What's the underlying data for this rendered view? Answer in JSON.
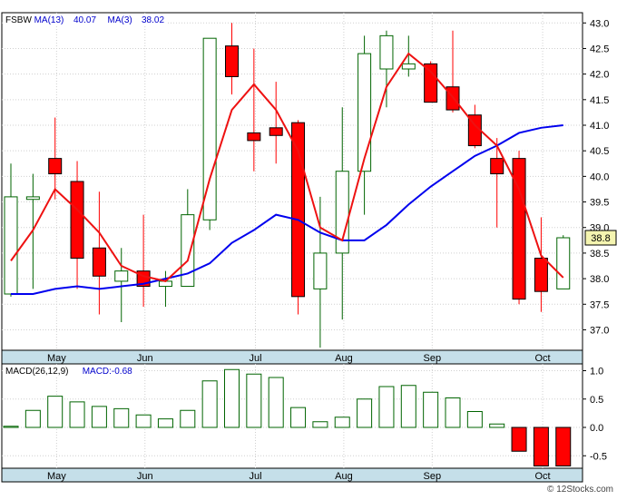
{
  "symbol": "FSBW",
  "credit": "© 12Stocks.com",
  "colors": {
    "up": "#006400",
    "down": "#ff0000",
    "ma_long": "#0000ee",
    "ma_short": "#ee1111",
    "axis_band": "#c5dfe9",
    "grid": "#d0d0d0"
  },
  "chart_data": [
    {
      "type": "candlestick",
      "legend": [
        {
          "text": "FSBW",
          "color": "#000000"
        },
        {
          "text": "MA(13)",
          "color": "#0000cc"
        },
        {
          "text": "40.07",
          "color": "#0000cc"
        },
        {
          "text": "MA(3)",
          "color": "#0000cc"
        },
        {
          "text": "38.02",
          "color": "#0000cc"
        }
      ],
      "last_price_label": "38.8",
      "ylim": [
        36.6,
        43.2
      ],
      "y_ticks": [
        "43.0",
        "42.5",
        "42.0",
        "41.5",
        "41.0",
        "40.5",
        "40.0",
        "39.5",
        "39.0",
        "38.5",
        "38.0",
        "37.5",
        "37.0"
      ],
      "x_ticks": [
        {
          "label": "May",
          "i": 1
        },
        {
          "label": "Jun",
          "i": 5
        },
        {
          "label": "Jul",
          "i": 10
        },
        {
          "label": "Aug",
          "i": 14
        },
        {
          "label": "Sep",
          "i": 18
        },
        {
          "label": "Oct",
          "i": 23
        }
      ],
      "candles": [
        {
          "o": 37.7,
          "h": 40.25,
          "l": 37.65,
          "c": 39.6
        },
        {
          "o": 39.55,
          "h": 40.05,
          "l": 37.8,
          "c": 39.6
        },
        {
          "o": 40.35,
          "h": 41.15,
          "l": 39.55,
          "c": 40.05
        },
        {
          "o": 39.9,
          "h": 40.3,
          "l": 37.8,
          "c": 38.4
        },
        {
          "o": 38.6,
          "h": 39.7,
          "l": 37.3,
          "c": 38.05
        },
        {
          "o": 37.95,
          "h": 38.6,
          "l": 37.15,
          "c": 38.15
        },
        {
          "o": 38.15,
          "h": 39.25,
          "l": 37.45,
          "c": 37.85
        },
        {
          "o": 37.85,
          "h": 38.15,
          "l": 37.45,
          "c": 37.95
        },
        {
          "o": 37.85,
          "h": 39.75,
          "l": 37.85,
          "c": 39.25
        },
        {
          "o": 39.15,
          "h": 42.65,
          "l": 38.95,
          "c": 42.7
        },
        {
          "o": 42.55,
          "h": 43.0,
          "l": 41.6,
          "c": 41.95
        },
        {
          "o": 40.85,
          "h": 42.5,
          "l": 40.1,
          "c": 40.7
        },
        {
          "o": 40.95,
          "h": 41.85,
          "l": 40.25,
          "c": 40.8
        },
        {
          "o": 41.05,
          "h": 41.1,
          "l": 37.3,
          "c": 37.65
        },
        {
          "o": 37.8,
          "h": 39.6,
          "l": 36.65,
          "c": 38.5
        },
        {
          "o": 38.5,
          "h": 41.35,
          "l": 37.2,
          "c": 40.1
        },
        {
          "o": 40.1,
          "h": 42.75,
          "l": 39.25,
          "c": 42.4
        },
        {
          "o": 42.1,
          "h": 42.85,
          "l": 41.35,
          "c": 42.75
        },
        {
          "o": 42.1,
          "h": 42.75,
          "l": 41.95,
          "c": 42.2
        },
        {
          "o": 42.2,
          "h": 42.25,
          "l": 41.45,
          "c": 41.45
        },
        {
          "o": 41.75,
          "h": 42.85,
          "l": 41.25,
          "c": 41.3
        },
        {
          "o": 41.2,
          "h": 41.4,
          "l": 40.55,
          "c": 40.6
        },
        {
          "o": 40.35,
          "h": 40.75,
          "l": 39.0,
          "c": 40.05
        },
        {
          "o": 40.35,
          "h": 40.5,
          "l": 37.5,
          "c": 37.6
        },
        {
          "o": 38.4,
          "h": 39.2,
          "l": 37.35,
          "c": 37.75
        },
        {
          "o": 37.8,
          "h": 38.85,
          "l": 37.8,
          "c": 38.8
        }
      ],
      "ma13": [
        37.7,
        37.7,
        37.8,
        37.85,
        37.8,
        37.85,
        37.9,
        38.0,
        38.1,
        38.3,
        38.7,
        38.95,
        39.25,
        39.15,
        38.9,
        38.75,
        38.75,
        39.05,
        39.45,
        39.8,
        40.1,
        40.4,
        40.6,
        40.85,
        40.95,
        41.0
      ],
      "ma13_start": 0,
      "ma3": [
        38.35,
        38.95,
        39.75,
        39.35,
        38.9,
        38.25,
        38.05,
        37.95,
        38.35,
        39.95,
        41.3,
        41.8,
        41.3,
        40.5,
        39.0,
        38.75,
        40.35,
        41.75,
        42.4,
        42.05,
        41.55,
        41.0,
        40.6,
        39.75,
        38.45,
        38.02
      ],
      "ma3_start": 0
    },
    {
      "type": "bar",
      "legend": [
        {
          "text": "MACD(26,12,9)",
          "color": "#000000"
        },
        {
          "text": "MACD:-0.68",
          "color": "#0000cc"
        }
      ],
      "ylim": [
        -0.72,
        1.12
      ],
      "y_ticks": [
        "1.0",
        "0.5",
        "0.0",
        "-0.5"
      ],
      "x_ticks": [
        {
          "label": "May",
          "i": 1
        },
        {
          "label": "Jun",
          "i": 5
        },
        {
          "label": "Jul",
          "i": 10
        },
        {
          "label": "Aug",
          "i": 14
        },
        {
          "label": "Sep",
          "i": 18
        },
        {
          "label": "Oct",
          "i": 23
        }
      ],
      "values": [
        0.02,
        0.3,
        0.55,
        0.45,
        0.37,
        0.33,
        0.22,
        0.15,
        0.3,
        0.82,
        1.02,
        0.94,
        0.88,
        0.35,
        0.1,
        0.18,
        0.5,
        0.72,
        0.74,
        0.62,
        0.52,
        0.28,
        0.06,
        -0.42,
        -0.68,
        -0.68
      ]
    }
  ]
}
